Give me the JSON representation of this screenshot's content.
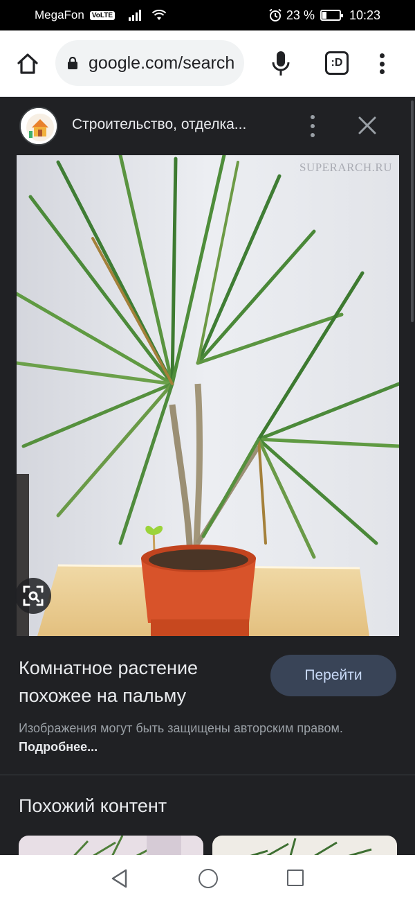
{
  "status_bar": {
    "carrier": "MegaFon",
    "volte": "VoLTE",
    "battery_percent": "23 %",
    "battery_level": 0.23,
    "time": "10:23"
  },
  "browser": {
    "url": "google.com/search",
    "tab_label": ":D"
  },
  "panel": {
    "site_title": "Строительство, отделка...",
    "image_watermark": "SUPERARCH.RU",
    "image_title": "Комнатное растение похожее на пальму",
    "visit_button": "Перейти",
    "copyright_text": "Изображения могут быть защищены авторским правом.",
    "copyright_link": "Подробнее..."
  },
  "similar": {
    "title": "Похожий контент"
  },
  "icons": {
    "home": "home-icon",
    "lock": "lock-icon",
    "mic": "microphone-icon",
    "tabs": "tab-switcher-icon",
    "menu": "more-vert-icon",
    "close": "close-icon",
    "lens": "google-lens-icon",
    "back": "nav-back-icon",
    "nav_home": "nav-home-icon",
    "recent": "nav-recent-icon"
  },
  "colors": {
    "panel_bg": "#202124",
    "visit_button_bg": "#394457",
    "visit_button_text": "#c9daf8"
  }
}
